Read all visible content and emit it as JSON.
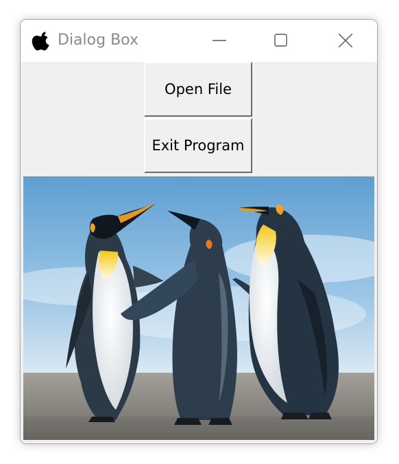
{
  "window": {
    "title": "Dialog Box",
    "app_icon": "apple-icon",
    "controls": [
      "minimize-icon",
      "maximize-icon",
      "close-icon"
    ]
  },
  "buttons": {
    "open_file": "Open File",
    "exit_program": "Exit Program"
  },
  "image": {
    "subject": "penguins-photo"
  },
  "colors": {
    "window_bg": "#f0f0f0",
    "titlebar_bg": "#ffffff",
    "title_text": "#8a8a8a",
    "sky": "#7fb6dd",
    "ground": "#8f8c86"
  }
}
